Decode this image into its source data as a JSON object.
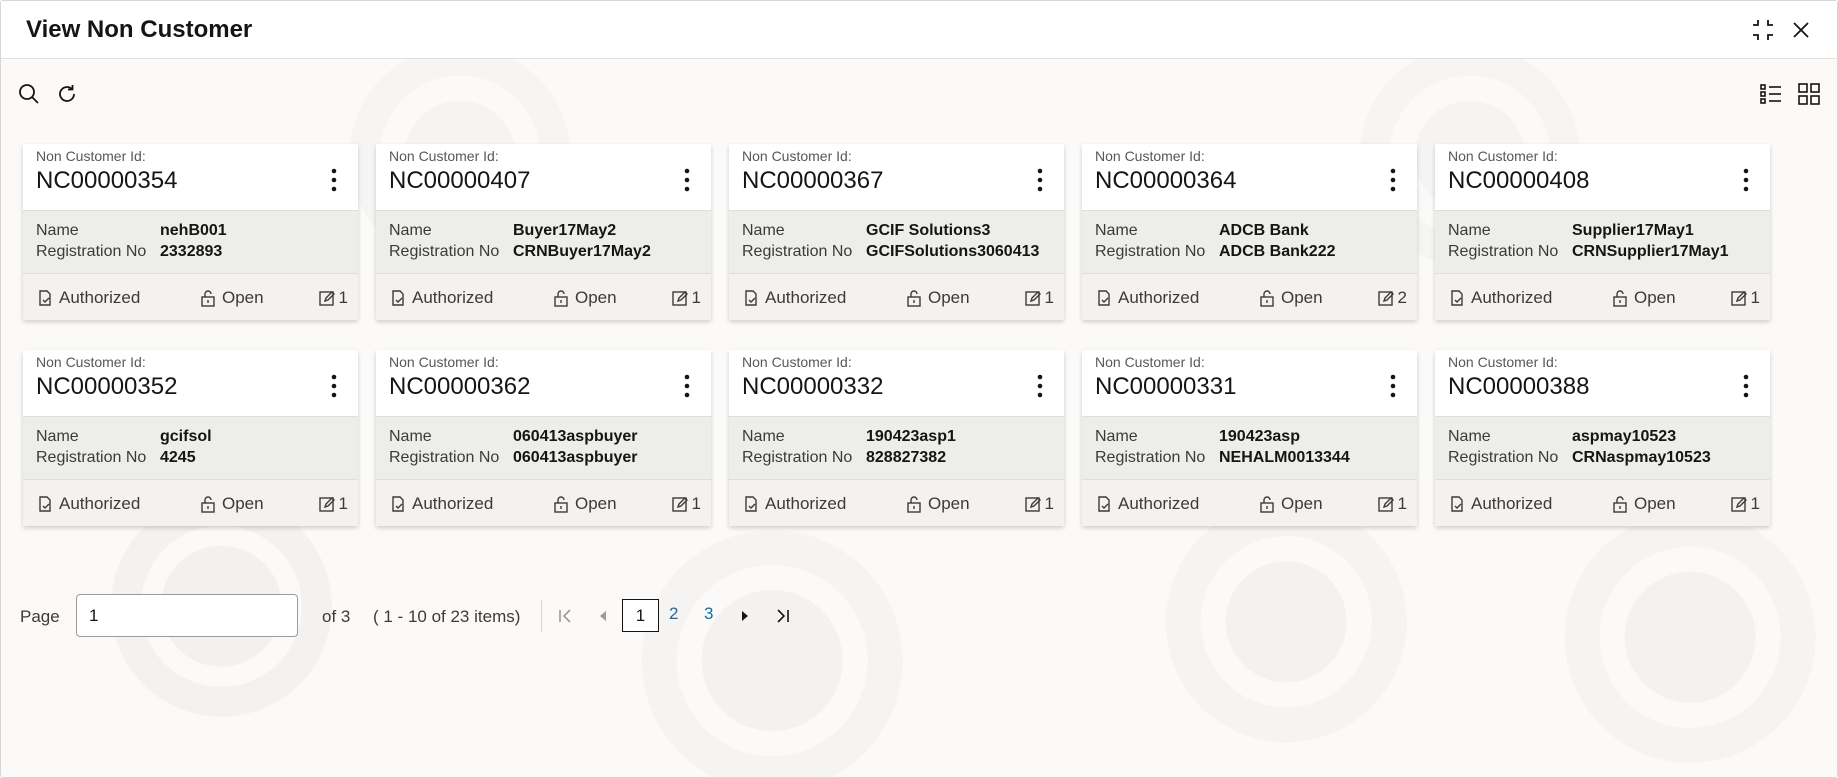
{
  "window": {
    "title": "View Non Customer"
  },
  "toolbar": {
    "search_icon": "search-icon",
    "refresh_icon": "refresh-icon",
    "list_view_icon": "list-view-icon",
    "tile_view_icon": "tile-view-icon"
  },
  "card_labels": {
    "id_label": "Non Customer Id:",
    "name_label": "Name",
    "reg_label": "Registration No",
    "auth_label": "Authorized",
    "open_label": "Open"
  },
  "cards": [
    {
      "id": "NC00000354",
      "name": "nehB001",
      "reg": "2332893",
      "count": "1"
    },
    {
      "id": "NC00000407",
      "name": "Buyer17May2",
      "reg": "CRNBuyer17May2",
      "count": "1"
    },
    {
      "id": "NC00000367",
      "name": "GCIF Solutions3",
      "reg": "GCIFSolutions3060413",
      "count": "1"
    },
    {
      "id": "NC00000364",
      "name": "ADCB Bank",
      "reg": "ADCB Bank222",
      "count": "2"
    },
    {
      "id": "NC00000408",
      "name": "Supplier17May1",
      "reg": "CRNSupplier17May1",
      "count": "1"
    },
    {
      "id": "NC00000352",
      "name": "gcifsol",
      "reg": "4245",
      "count": "1"
    },
    {
      "id": "NC00000362",
      "name": "060413aspbuyer",
      "reg": "060413aspbuyer",
      "count": "1"
    },
    {
      "id": "NC00000332",
      "name": "190423asp1",
      "reg": "828827382",
      "count": "1"
    },
    {
      "id": "NC00000331",
      "name": "190423asp",
      "reg": "NEHALM0013344",
      "count": "1"
    },
    {
      "id": "NC00000388",
      "name": "aspmay10523",
      "reg": "CRNaspmay10523",
      "count": "1"
    }
  ],
  "pagination": {
    "page_label": "Page",
    "page_value": "1",
    "of_text": "of 3",
    "range_text": "( 1 - 10 of 23 items)",
    "pages": [
      "1",
      "2",
      "3"
    ],
    "current_page": "1"
  },
  "colors": {
    "link": "#0f6fa3",
    "text": "#161513",
    "card_body": "#ededeb"
  }
}
